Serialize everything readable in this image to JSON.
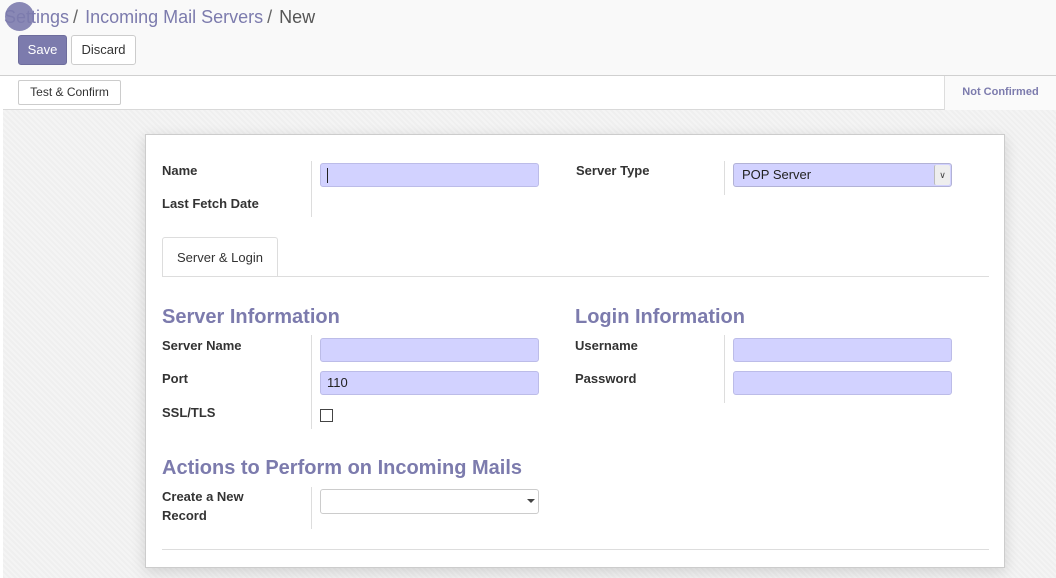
{
  "breadcrumb": {
    "settings": "Settings",
    "separator": "/",
    "incoming_mail_servers": "Incoming Mail Servers",
    "current": "New"
  },
  "toolbar": {
    "save_label": "Save",
    "discard_label": "Discard"
  },
  "statusbar": {
    "test_confirm_label": "Test & Confirm",
    "status": "Not Confirmed"
  },
  "form": {
    "name_label": "Name",
    "name_value": "",
    "last_fetch_label": "Last Fetch Date",
    "server_type_label": "Server Type",
    "server_type_value": "POP Server",
    "tab_label": "Server & Login",
    "server_info_title": "Server Information",
    "server_name_label": "Server Name",
    "server_name_value": "",
    "port_label": "Port",
    "port_value": "110",
    "ssl_label": "SSL/TLS",
    "ssl_checked": false,
    "login_info_title": "Login Information",
    "username_label": "Username",
    "username_value": "",
    "password_label": "Password",
    "password_value": "",
    "actions_title": "Actions to Perform on Incoming Mails",
    "create_record_label_line1": "Create a New",
    "create_record_label_line2": "Record",
    "create_record_value": ""
  },
  "colors": {
    "brand": "#7c7bad",
    "input_required_bg": "#d2d2ff"
  }
}
